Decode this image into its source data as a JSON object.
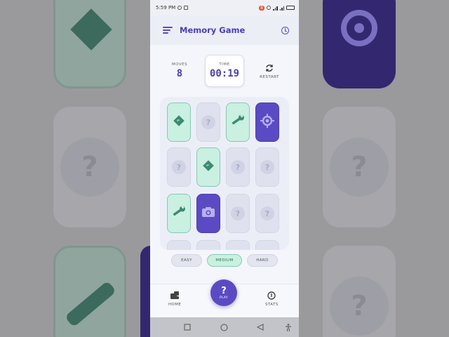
{
  "status_bar": {
    "time": "5:59 PM",
    "badge": "8"
  },
  "app": {
    "title": "Memory Game"
  },
  "stats": {
    "moves_label": "MOVES",
    "moves_value": "8",
    "time_label": "TIME",
    "time_value": "00:19",
    "restart_label": "RESTART"
  },
  "board": {
    "cards": [
      {
        "state": "revealed",
        "icon": "road-sign-icon",
        "style": "green"
      },
      {
        "state": "hidden",
        "icon": "question-icon",
        "style": "hidden"
      },
      {
        "state": "revealed",
        "icon": "wrench-icon",
        "style": "green"
      },
      {
        "state": "revealed",
        "icon": "crosshair-icon",
        "style": "purple"
      },
      {
        "state": "hidden",
        "icon": "question-icon",
        "style": "hidden"
      },
      {
        "state": "revealed",
        "icon": "road-sign-icon",
        "style": "green"
      },
      {
        "state": "hidden",
        "icon": "question-icon",
        "style": "hidden"
      },
      {
        "state": "hidden",
        "icon": "question-icon",
        "style": "hidden"
      },
      {
        "state": "revealed",
        "icon": "wrench-icon",
        "style": "green"
      },
      {
        "state": "revealed",
        "icon": "camera-icon",
        "style": "purple"
      },
      {
        "state": "hidden",
        "icon": "question-icon",
        "style": "hidden"
      },
      {
        "state": "hidden",
        "icon": "question-icon",
        "style": "hidden"
      }
    ],
    "hidden_symbol": "?"
  },
  "difficulty": {
    "easy": "EASY",
    "medium": "MEDIUM",
    "hard": "HARD",
    "selected": "MEDIUM"
  },
  "bottom_nav": {
    "home": "HOME",
    "play": "PLAY",
    "play_symbol": "?",
    "stats": "STATS"
  },
  "colors": {
    "accent": "#5a4bc4",
    "match_green": "#c9f0e1",
    "match_icon": "#3c8a73",
    "background": "#f5f6fb"
  }
}
